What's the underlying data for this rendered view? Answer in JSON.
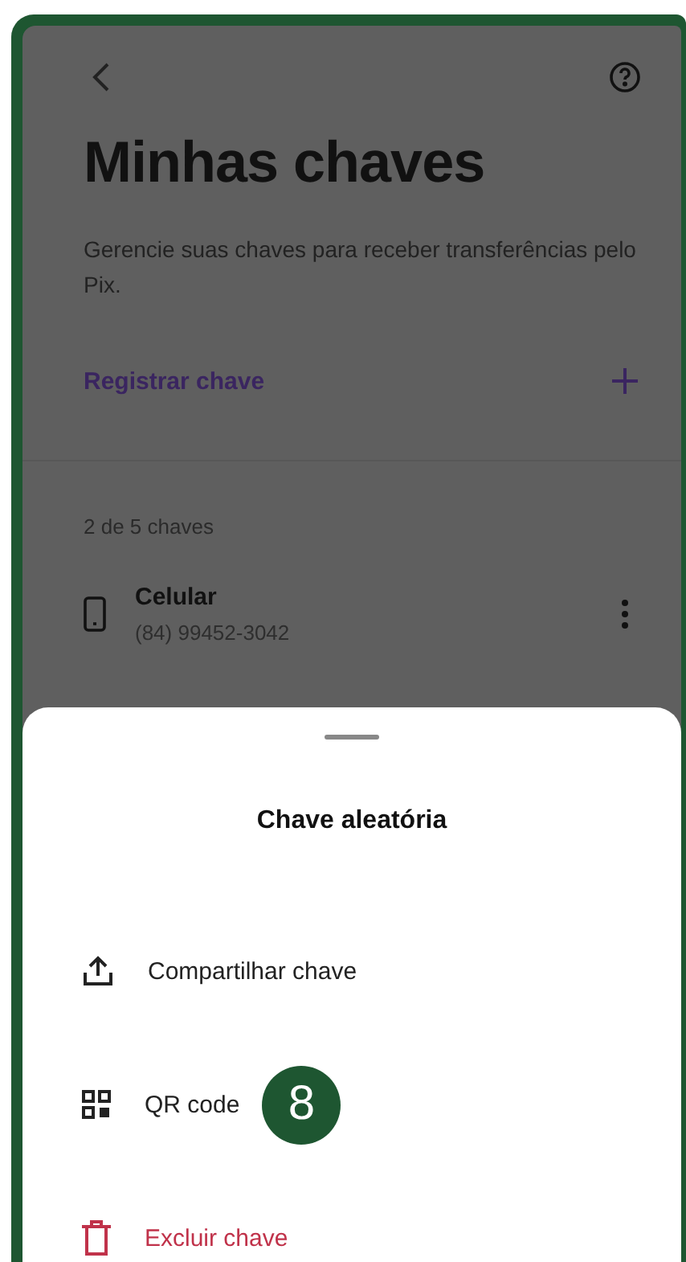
{
  "header": {
    "title": "Minhas chaves",
    "description": "Gerencie suas chaves para receber transferências pelo Pix."
  },
  "register": {
    "label": "Registrar chave"
  },
  "keys_count": "2 de 5 chaves",
  "keys": [
    {
      "name": "Celular",
      "value": "(84) 99452-3042"
    }
  ],
  "sheet": {
    "title": "Chave aleatória",
    "items": [
      {
        "kind": "share",
        "label": "Compartilhar chave"
      },
      {
        "kind": "qr",
        "label": "QR code",
        "badge": "8"
      },
      {
        "kind": "delete",
        "label": "Excluir chave"
      }
    ]
  }
}
